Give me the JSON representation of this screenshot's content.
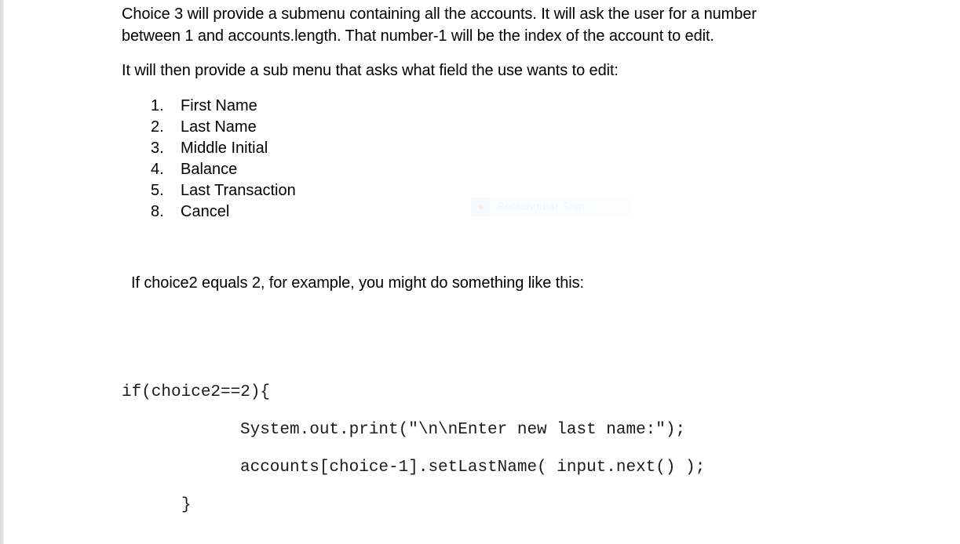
{
  "document": {
    "paragraph1_line1": "Choice 3 will provide a submenu containing all the accounts.  It will ask the user for a number",
    "paragraph1_line2": "between 1 and accounts.length.  That number-1 will be the index of the account to edit.",
    "paragraph2": "It will then provide a sub menu that asks what field the use wants to edit:",
    "menu_items": [
      {
        "number": "1.",
        "label": "First Name"
      },
      {
        "number": "2.",
        "label": "Last Name"
      },
      {
        "number": "3.",
        "label": "Middle Initial"
      },
      {
        "number": "4.",
        "label": "Balance"
      },
      {
        "number": "5.",
        "label": "Last Transaction"
      },
      {
        "number": "8.",
        "label": "Cancel"
      }
    ],
    "paragraph3": "If choice2 equals 2, for example, you might do something like this:",
    "code_lines": [
      "if(choice2==2){",
      "System.out.print(\"\\n\\nEnter new last name:\");",
      "accounts[choice-1].setLastName( input.next() );",
      "}"
    ]
  },
  "overlay": {
    "snip_label": "Rectangular Snip",
    "snip_icon": "snip-tool-icon"
  }
}
